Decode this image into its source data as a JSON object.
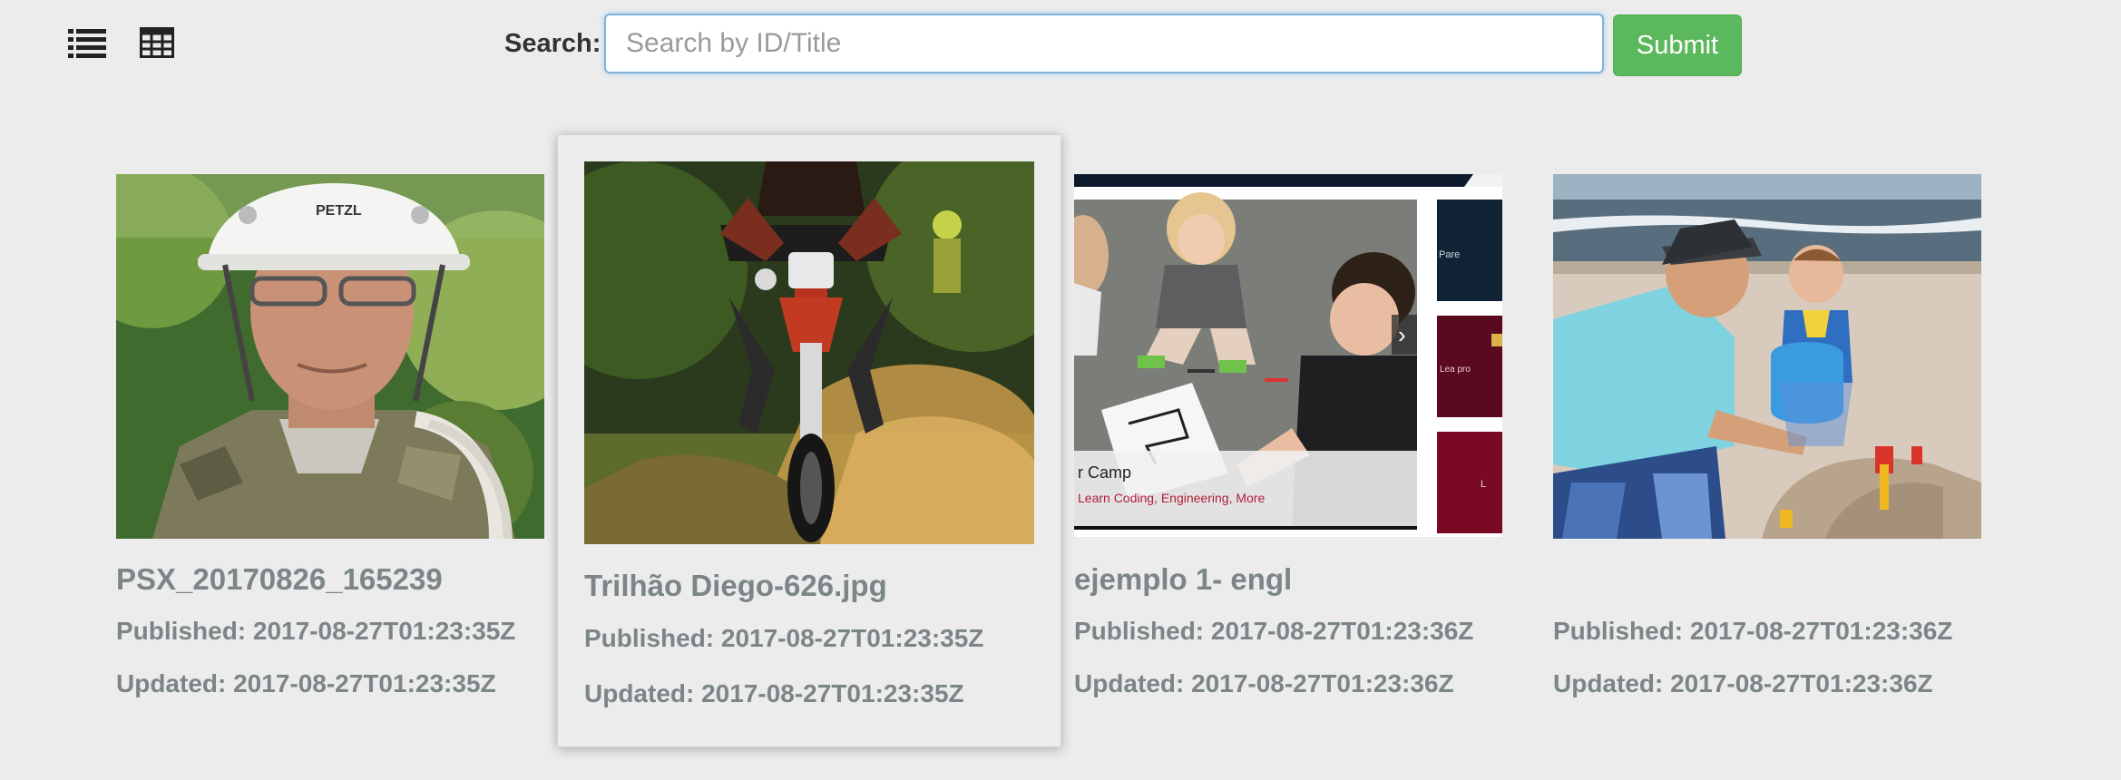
{
  "toolbar": {
    "list_icon": "list-view-icon",
    "grid_icon": "grid-view-icon"
  },
  "search": {
    "label": "Search:",
    "placeholder": "Search by ID/Title",
    "value": "",
    "submit_label": "Submit"
  },
  "colors": {
    "background": "#ececec",
    "submit": "#5cb85c",
    "meta_text": "#7c8587",
    "input_focus": "#7eb3e0"
  },
  "items": [
    {
      "title": "PSX_20170826_165239",
      "published": "Published: 2017-08-27T01:23:35Z",
      "updated": "Updated: 2017-08-27T01:23:35Z",
      "helmet_text": "PETZL"
    },
    {
      "title": "Trilhão Diego-626.jpg",
      "published": "Published: 2017-08-27T01:23:35Z",
      "updated": "Updated: 2017-08-27T01:23:35Z"
    },
    {
      "title": "ejemplo 1- engl",
      "published": "Published: 2017-08-27T01:23:36Z",
      "updated": "Updated: 2017-08-27T01:23:36Z",
      "slide_title": "r Camp",
      "slide_subtitle": "Learn Coding, Engineering, More",
      "side_tile_1": "Pare",
      "side_tile_2": "Lea pro",
      "side_tile_3": "L",
      "slider_arrow": "›"
    },
    {
      "title": "",
      "published": "Published: 2017-08-27T01:23:36Z",
      "updated": "Updated: 2017-08-27T01:23:36Z"
    }
  ]
}
